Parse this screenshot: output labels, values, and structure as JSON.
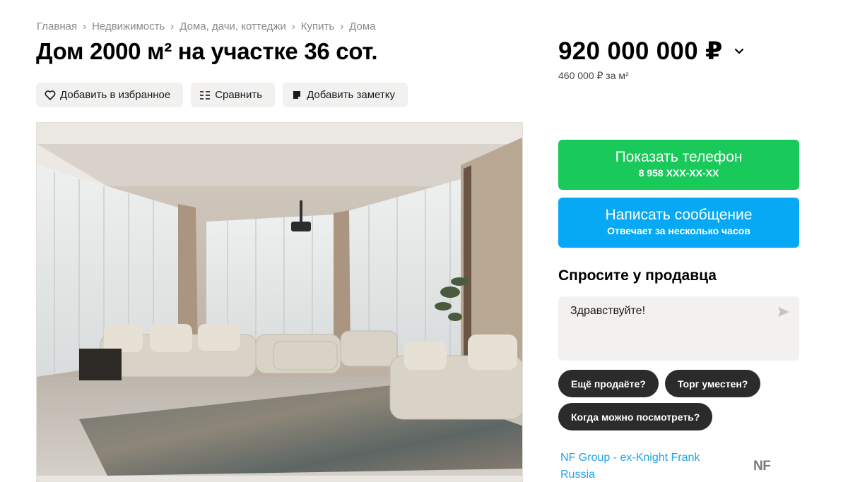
{
  "breadcrumb": [
    "Главная",
    "Недвижимость",
    "Дома, дачи, коттеджи",
    "Купить",
    "Дома"
  ],
  "title": "Дом 2000 м² на участке 36 сот.",
  "actions": {
    "favorite": "Добавить в избранное",
    "compare": "Сравнить",
    "note": "Добавить заметку"
  },
  "price": {
    "value": "920 000 000 ₽",
    "per_meter": "460 000 ₽ за м²"
  },
  "contact": {
    "phone_label": "Показать телефон",
    "phone_masked": "8 958 XXX-XX-XX",
    "message_label": "Написать сообщение",
    "message_sub": "Отвечает за несколько часов"
  },
  "ask": {
    "title": "Спросите у продавца",
    "input_value": "Здравствуйте!",
    "chips": [
      "Ещё продаёте?",
      "Торг уместен?",
      "Когда можно посмотреть?"
    ]
  },
  "agency": {
    "name": "NF Group - ex-Knight Frank Russia",
    "logo": "NF"
  },
  "colors": {
    "phone_button": "#19c95a",
    "message_button": "#07a9f4",
    "agency_link": "#1fa3e8",
    "chip": "#2b2b2b"
  },
  "icons": {
    "breadcrumb_separator": "chevron-right-icon",
    "favorite": "heart-icon",
    "compare": "compare-icon",
    "note": "note-icon",
    "price_toggle": "chevron-down-icon",
    "send": "send-icon"
  }
}
